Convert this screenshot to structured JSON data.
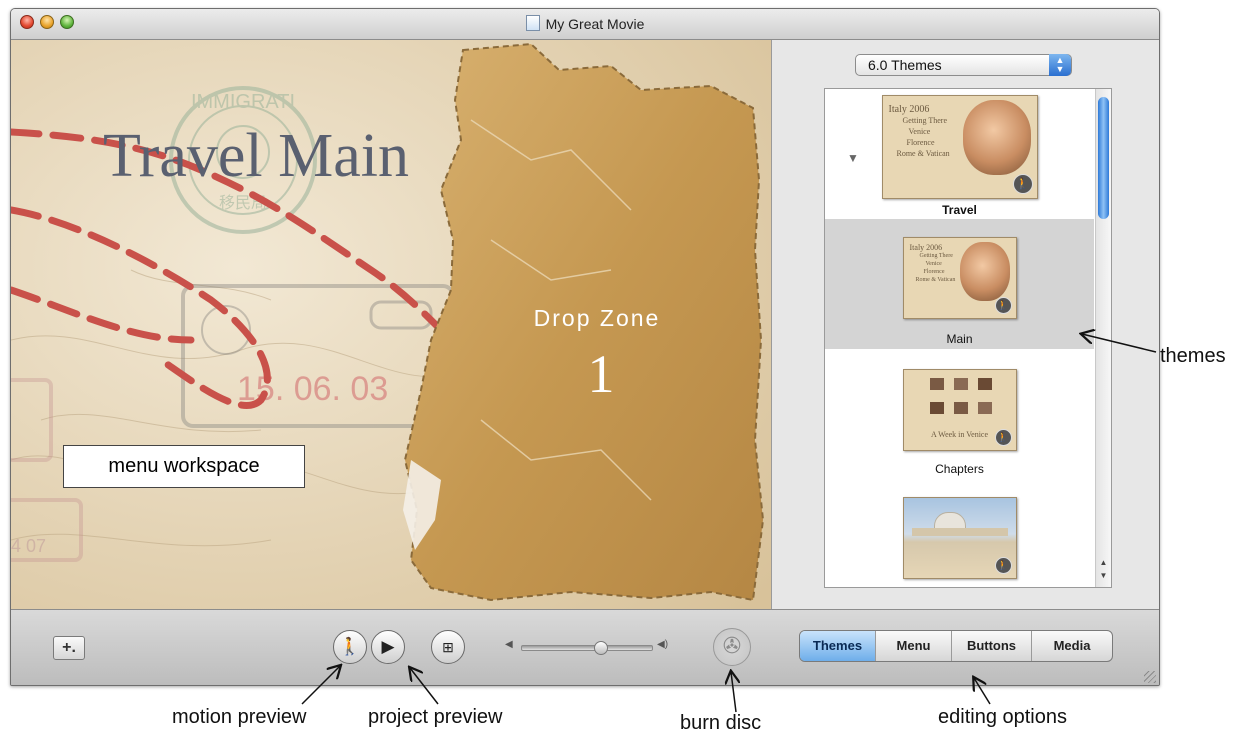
{
  "window": {
    "title": "My Great Movie"
  },
  "menu": {
    "title": "Travel Main",
    "drop_zone_label": "Drop Zone",
    "drop_zone_number": "1",
    "stamp_date": "15. 06. 03",
    "stamp_small": "4 07",
    "seal_top": "IMMIGRATI",
    "seal_bottom": "移民局"
  },
  "themes": {
    "selector_value": "6.0 Themes",
    "items": [
      {
        "label": "Travel",
        "thumb_lines": [
          "Italy 2006",
          "Getting There",
          "Venice",
          "Florence",
          "Rome & Vatican"
        ],
        "selected": false
      },
      {
        "label": "Main",
        "thumb_lines": [
          "Italy 2006",
          "Getting There",
          "Venice",
          "Florence",
          "Rome & Vatican"
        ],
        "selected": true
      },
      {
        "label": "Chapters",
        "thumb_lines": [
          "A Week in Venice"
        ],
        "selected": false
      },
      {
        "label": "",
        "thumb_lines": [],
        "selected": false
      }
    ]
  },
  "toolbar": {
    "add_label": "+.",
    "tabs": [
      {
        "label": "Themes",
        "active": true
      },
      {
        "label": "Menu",
        "active": false
      },
      {
        "label": "Buttons",
        "active": false
      },
      {
        "label": "Media",
        "active": false
      }
    ],
    "volume": 0.6
  },
  "callouts": {
    "menu_workspace": "menu workspace",
    "themes": "themes",
    "motion_preview": "motion preview",
    "project_preview": "project preview",
    "burn_disc": "burn disc",
    "editing_options": "editing options"
  },
  "colors": {
    "accent": "#2e7ad8",
    "paper": "#c79a55",
    "dashed_line": "#c9514a"
  },
  "icons": {
    "motion": "walking-man-icon",
    "play": "play-icon",
    "map": "sitemap-icon",
    "burn": "burn-disc-icon"
  }
}
